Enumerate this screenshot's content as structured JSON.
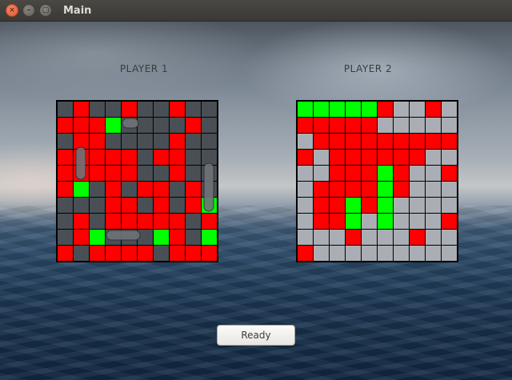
{
  "window": {
    "title": "Main",
    "controls": [
      "×",
      "–",
      "▢"
    ]
  },
  "players": [
    {
      "label": "PLAYER 1",
      "grid": [
        "-R--R--R-",
        "RRRG----R",
        "-RR----R-",
        "RRRRR-RR-",
        "RRRRR--R-",
        "RG-R-RR-R",
        "---RR-R-RG",
        "-R-RRRRR-R",
        "-RG---GR-G",
        "R-RRRR-RRR"
      ],
      "ships": [
        "ship-vertical-1",
        "ship-vertical-2",
        "ship-horizontal-1",
        "ship-horizontal-2"
      ]
    },
    {
      "label": "PLAYER 2",
      "grid": [
        "GGGGGR--R-",
        "RRRRR-----",
        "-RRRRRRRRR",
        "R-RRRRRR--",
        "--RRRGR--R",
        "-RRRRGR---",
        "-RRGRG----",
        "-RRG-G---R",
        "---R---R--",
        "R---------"
      ]
    }
  ],
  "cell_colors": {
    "hit": "#ff0000",
    "sunk": "#00ff00",
    "water_p1": "rgba(210,225,240,0.35)",
    "water_p2": "rgba(200,205,212,0.85)",
    "grid_line": "#000000"
  },
  "ready_button": {
    "label": "Ready"
  }
}
